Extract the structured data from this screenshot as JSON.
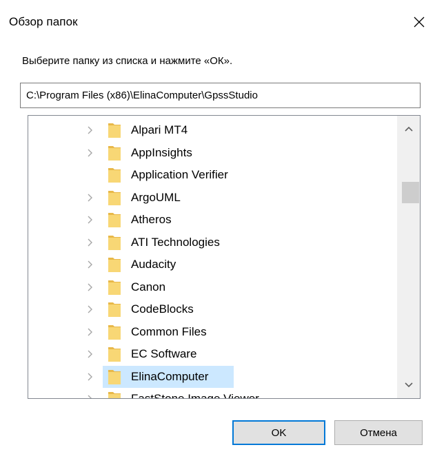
{
  "window": {
    "title": "Обзор папок"
  },
  "prompt": "Выберите папку из списка и нажмите «ОК».",
  "path_field": {
    "value": "C:\\Program Files (x86)\\ElinaComputer\\GpssStudio"
  },
  "folders": [
    {
      "label": "Alpari MT4",
      "expandable": true
    },
    {
      "label": "AppInsights",
      "expandable": true
    },
    {
      "label": "Application Verifier",
      "expandable": false
    },
    {
      "label": "ArgoUML",
      "expandable": true
    },
    {
      "label": "Atheros",
      "expandable": true
    },
    {
      "label": "ATI Technologies",
      "expandable": true
    },
    {
      "label": "Audacity",
      "expandable": true
    },
    {
      "label": "Canon",
      "expandable": true
    },
    {
      "label": "CodeBlocks",
      "expandable": true
    },
    {
      "label": "Common Files",
      "expandable": true
    },
    {
      "label": "EC Software",
      "expandable": true
    },
    {
      "label": "ElinaComputer",
      "expandable": true,
      "selected": true
    },
    {
      "label": "FastStone Image Viewer",
      "expandable": true
    }
  ],
  "buttons": {
    "ok_label": "OK",
    "cancel_label": "Отмена"
  },
  "icons": {
    "close": "close-icon",
    "folder": "folder-icon",
    "expander": "chevron-right-icon",
    "scroll_up": "chevron-up-icon",
    "scroll_down": "chevron-down-icon"
  },
  "colors": {
    "selection": "#cce8ff",
    "folder": "#f8d775",
    "accent": "#0078d7"
  }
}
